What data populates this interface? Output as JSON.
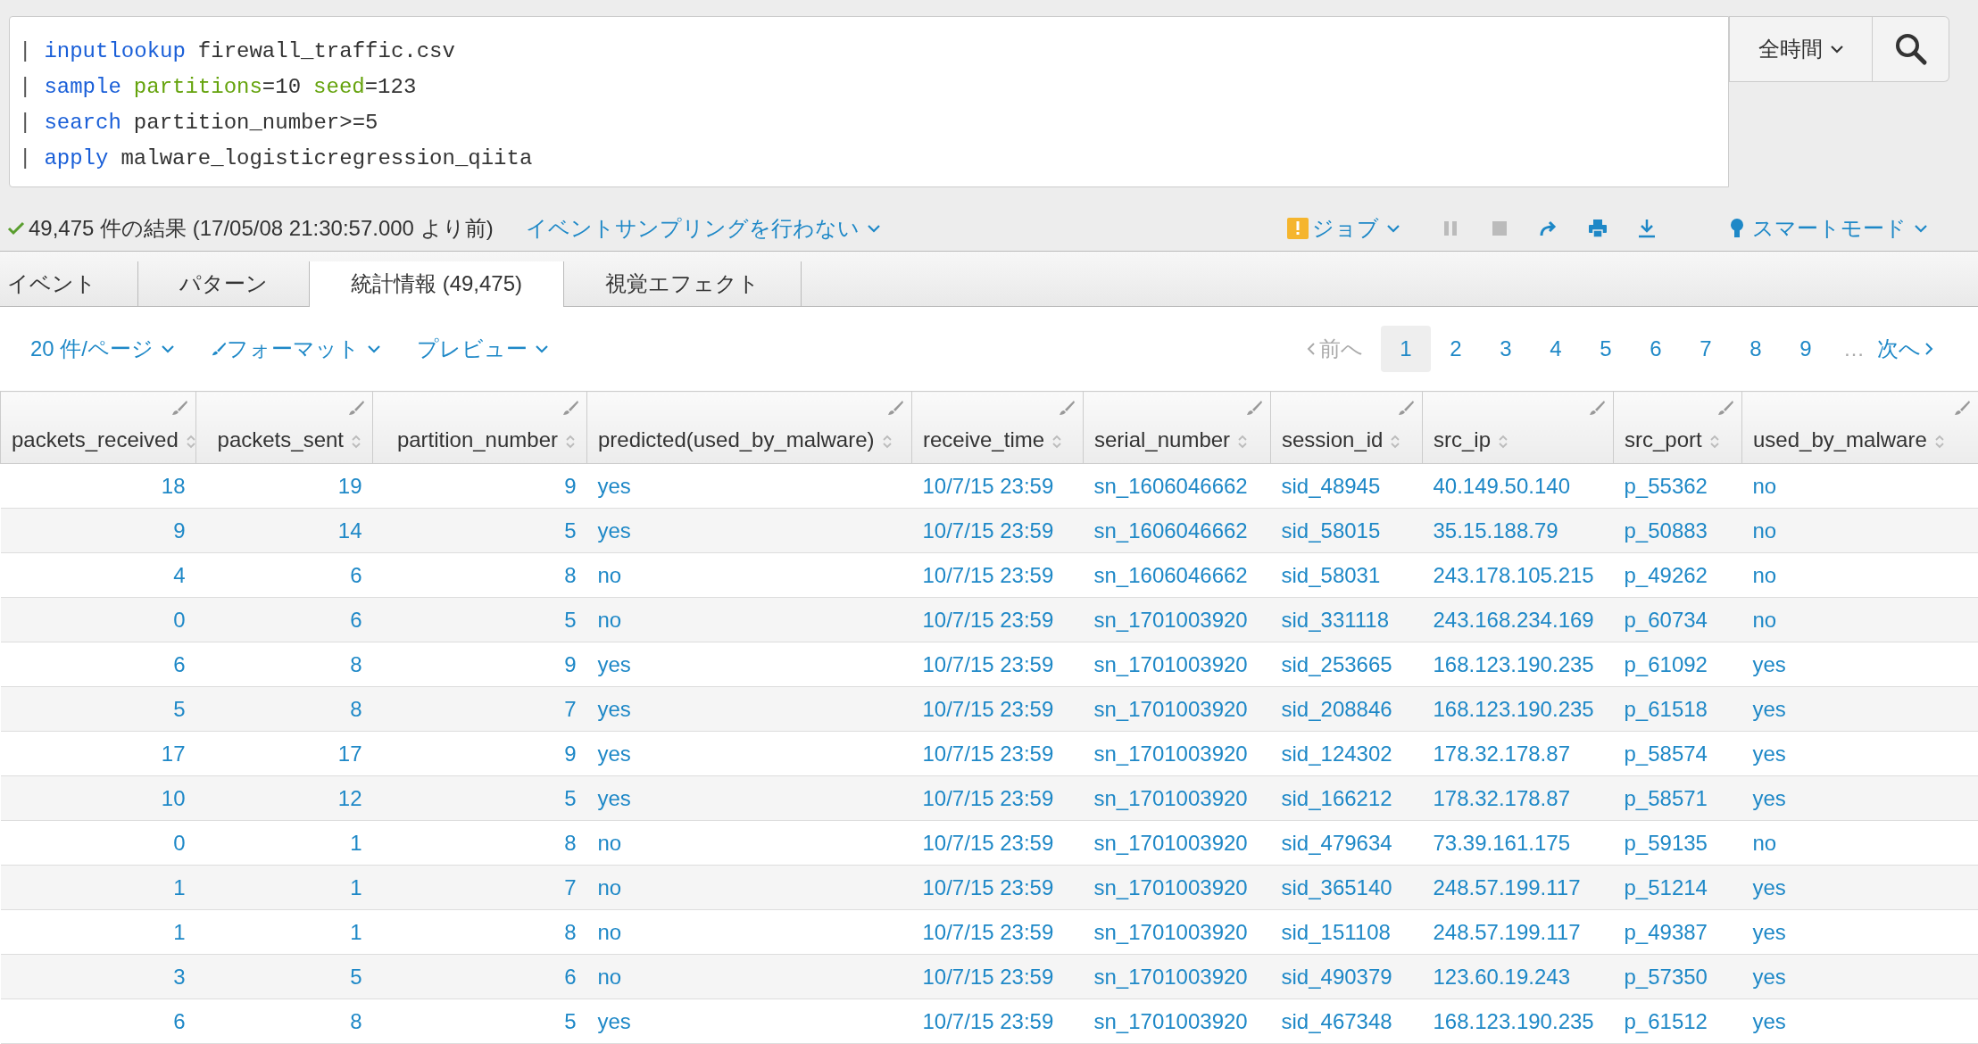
{
  "query": {
    "lines": [
      {
        "tokens": [
          {
            "text": "|",
            "kind": "pipe"
          },
          {
            "text": "inputlookup",
            "kind": "command"
          },
          {
            "text": "firewall_traffic.csv",
            "kind": "plain"
          }
        ]
      },
      {
        "tokens": [
          {
            "text": "|",
            "kind": "pipe"
          },
          {
            "text": "sample",
            "kind": "command"
          },
          {
            "text": "partitions",
            "kind": "arg"
          },
          {
            "text": "=10",
            "kind": "plain"
          },
          {
            "text": "seed",
            "kind": "arg"
          },
          {
            "text": "=123",
            "kind": "plain"
          }
        ]
      },
      {
        "tokens": [
          {
            "text": "|",
            "kind": "pipe"
          },
          {
            "text": "search",
            "kind": "command"
          },
          {
            "text": "partition_number>=5",
            "kind": "plain"
          }
        ]
      },
      {
        "tokens": [
          {
            "text": "|",
            "kind": "pipe"
          },
          {
            "text": "apply",
            "kind": "command"
          },
          {
            "text": "malware_logisticregression_qiita",
            "kind": "plain"
          }
        ]
      }
    ],
    "time_range": "全時間"
  },
  "status": {
    "summary": "49,475 件の結果 (17/05/08 21:30:57.000 より前)",
    "sampling": "イベントサンプリングを行わない",
    "job": "ジョブ",
    "mode": "スマートモード"
  },
  "job_controls": [
    {
      "kind": "pause",
      "disabled": true
    },
    {
      "kind": "stop",
      "disabled": true
    },
    {
      "kind": "share",
      "disabled": false
    },
    {
      "kind": "print",
      "disabled": false
    },
    {
      "kind": "export",
      "disabled": false
    }
  ],
  "tabs": [
    {
      "label": "イベント",
      "selected": false
    },
    {
      "label": "パターン",
      "selected": false
    },
    {
      "label": "統計情報 (49,475)",
      "selected": true
    },
    {
      "label": "視覚エフェクト",
      "selected": false
    }
  ],
  "table_options": [
    "20 件/ページ",
    "フォーマット",
    "プレビュー"
  ],
  "pagination": {
    "prev": {
      "label": "前へ",
      "disabled": true
    },
    "pages": [
      {
        "label": "1",
        "selected": true
      },
      {
        "label": "2",
        "selected": false
      },
      {
        "label": "3",
        "selected": false
      },
      {
        "label": "4",
        "selected": false
      },
      {
        "label": "5",
        "selected": false
      },
      {
        "label": "6",
        "selected": false
      },
      {
        "label": "7",
        "selected": false
      },
      {
        "label": "8",
        "selected": false
      },
      {
        "label": "9",
        "selected": false
      }
    ],
    "ellipsis": "…",
    "next": {
      "label": "次へ",
      "disabled": false
    }
  },
  "table": {
    "columns": [
      {
        "label": "packets_received",
        "numeric": true
      },
      {
        "label": "packets_sent",
        "numeric": true
      },
      {
        "label": "partition_number",
        "numeric": true
      },
      {
        "label": "predicted(used_by_malware)",
        "numeric": false
      },
      {
        "label": "receive_time",
        "numeric": false
      },
      {
        "label": "serial_number",
        "numeric": false
      },
      {
        "label": "session_id",
        "numeric": false
      },
      {
        "label": "src_ip",
        "numeric": false
      },
      {
        "label": "src_port",
        "numeric": false
      },
      {
        "label": "used_by_malware",
        "numeric": false
      }
    ],
    "rows": [
      [
        "18",
        "19",
        "9",
        "yes",
        "10/7/15 23:59",
        "sn_1606046662",
        "sid_48945",
        "40.149.50.140",
        "p_55362",
        "no"
      ],
      [
        "9",
        "14",
        "5",
        "yes",
        "10/7/15 23:59",
        "sn_1606046662",
        "sid_58015",
        "35.15.188.79",
        "p_50883",
        "no"
      ],
      [
        "4",
        "6",
        "8",
        "no",
        "10/7/15 23:59",
        "sn_1606046662",
        "sid_58031",
        "243.178.105.215",
        "p_49262",
        "no"
      ],
      [
        "0",
        "6",
        "5",
        "no",
        "10/7/15 23:59",
        "sn_1701003920",
        "sid_331118",
        "243.168.234.169",
        "p_60734",
        "no"
      ],
      [
        "6",
        "8",
        "9",
        "yes",
        "10/7/15 23:59",
        "sn_1701003920",
        "sid_253665",
        "168.123.190.235",
        "p_61092",
        "yes"
      ],
      [
        "5",
        "8",
        "7",
        "yes",
        "10/7/15 23:59",
        "sn_1701003920",
        "sid_208846",
        "168.123.190.235",
        "p_61518",
        "yes"
      ],
      [
        "17",
        "17",
        "9",
        "yes",
        "10/7/15 23:59",
        "sn_1701003920",
        "sid_124302",
        "178.32.178.87",
        "p_58574",
        "yes"
      ],
      [
        "10",
        "12",
        "5",
        "yes",
        "10/7/15 23:59",
        "sn_1701003920",
        "sid_166212",
        "178.32.178.87",
        "p_58571",
        "yes"
      ],
      [
        "0",
        "1",
        "8",
        "no",
        "10/7/15 23:59",
        "sn_1701003920",
        "sid_479634",
        "73.39.161.175",
        "p_59135",
        "no"
      ],
      [
        "1",
        "1",
        "7",
        "no",
        "10/7/15 23:59",
        "sn_1701003920",
        "sid_365140",
        "248.57.199.117",
        "p_51214",
        "yes"
      ],
      [
        "1",
        "1",
        "8",
        "no",
        "10/7/15 23:59",
        "sn_1701003920",
        "sid_151108",
        "248.57.199.117",
        "p_49387",
        "yes"
      ],
      [
        "3",
        "5",
        "6",
        "no",
        "10/7/15 23:59",
        "sn_1701003920",
        "sid_490379",
        "123.60.19.243",
        "p_57350",
        "yes"
      ],
      [
        "6",
        "8",
        "5",
        "yes",
        "10/7/15 23:59",
        "sn_1701003920",
        "sid_467348",
        "168.123.190.235",
        "p_61512",
        "yes"
      ]
    ]
  }
}
